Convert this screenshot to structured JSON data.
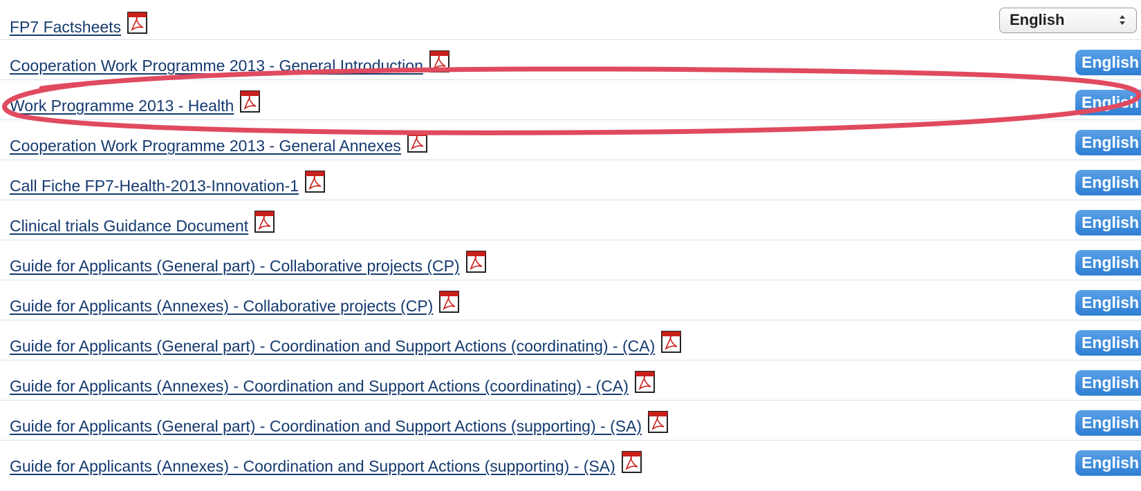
{
  "language_select": {
    "selected": "English",
    "icon": "select-arrows-icon"
  },
  "documents": [
    {
      "title": "FP7 Factsheets",
      "icon": "pdf-icon"
    },
    {
      "title": "Cooperation Work Programme 2013 - General Introduction",
      "language": "English",
      "icon": "pdf-icon"
    },
    {
      "title": "Work Programme 2013 - Health",
      "language": "English",
      "icon": "pdf-icon",
      "highlighted": true
    },
    {
      "title": "Cooperation Work Programme 2013 - General Annexes",
      "language": "English",
      "icon": "pdf-icon"
    },
    {
      "title": "Call Fiche FP7-Health-2013-Innovation-1",
      "language": "English",
      "icon": "pdf-icon"
    },
    {
      "title": "Clinical trials Guidance Document",
      "language": "English",
      "icon": "pdf-icon"
    },
    {
      "title": "Guide for Applicants (General part) - Collaborative projects (CP)",
      "language": "English",
      "icon": "pdf-icon"
    },
    {
      "title": "Guide for Applicants (Annexes) - Collaborative projects (CP)",
      "language": "English",
      "icon": "pdf-icon"
    },
    {
      "title": "Guide for Applicants (General part) - Coordination and Support Actions (coordinating) - (CA)",
      "language": "English",
      "icon": "pdf-icon"
    },
    {
      "title": "Guide for Applicants (Annexes) - Coordination and Support Actions (coordinating) - (CA)",
      "language": "English",
      "icon": "pdf-icon"
    },
    {
      "title": "Guide for Applicants (General part) - Coordination and Support Actions (supporting) - (SA)",
      "language": "English",
      "icon": "pdf-icon"
    },
    {
      "title": "Guide for Applicants (Annexes) - Coordination and Support Actions (supporting) - (SA)",
      "language": "English",
      "icon": "pdf-icon"
    }
  ],
  "colors": {
    "link": "#153a6f",
    "button": "#3a88da",
    "separator": "#d8e1ec",
    "highlight_ring": "#e04a5f"
  }
}
